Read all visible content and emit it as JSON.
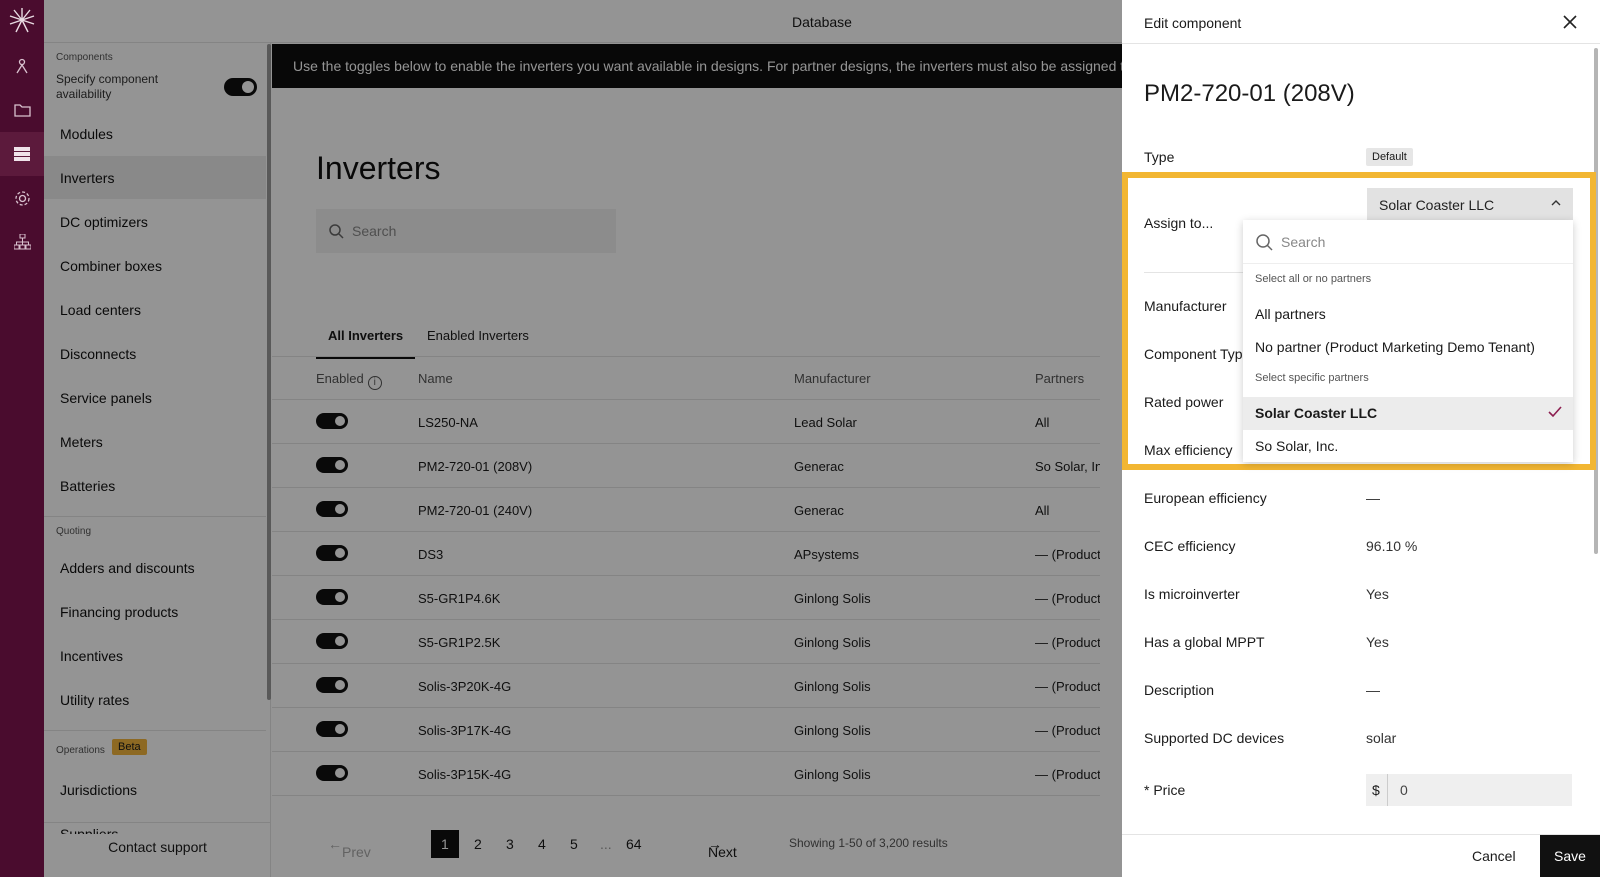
{
  "app": {
    "title": "Database"
  },
  "banner": "Use the toggles below to enable the inverters you want available in designs. For partner designs, the inverters must also be assigned to",
  "sidebar": {
    "components_title": "Components",
    "availability_label": "Specify component availability",
    "components": [
      "Modules",
      "Inverters",
      "DC optimizers",
      "Combiner boxes",
      "Load centers",
      "Disconnects",
      "Service panels",
      "Meters",
      "Batteries"
    ],
    "quoting_title": "Quoting",
    "quoting": [
      "Adders and discounts",
      "Financing products",
      "Incentives",
      "Utility rates"
    ],
    "operations_title": "Operations",
    "beta": "Beta",
    "operations": [
      "Jurisdictions",
      "Suppliers"
    ],
    "contact": "Contact support"
  },
  "main": {
    "title": "Inverters",
    "search_placeholder": "Search",
    "tabs": [
      "All Inverters",
      "Enabled Inverters"
    ],
    "columns": [
      "Enabled",
      "Name",
      "Manufacturer",
      "Partners"
    ],
    "rows": [
      {
        "name": "LS250-NA",
        "manufacturer": "Lead Solar",
        "partners": "All"
      },
      {
        "name": "PM2-720-01 (208V)",
        "manufacturer": "Generac",
        "partners": "So Solar, Inc."
      },
      {
        "name": "PM2-720-01 (240V)",
        "manufacturer": "Generac",
        "partners": "All"
      },
      {
        "name": "DS3",
        "manufacturer": "APsystems",
        "partners": "— (Product M"
      },
      {
        "name": "S5-GR1P4.6K",
        "manufacturer": "Ginlong Solis",
        "partners": "— (Product M"
      },
      {
        "name": "S5-GR1P2.5K",
        "manufacturer": "Ginlong Solis",
        "partners": "— (Product M"
      },
      {
        "name": "Solis-3P20K-4G",
        "manufacturer": "Ginlong Solis",
        "partners": "— (Product M"
      },
      {
        "name": "Solis-3P17K-4G",
        "manufacturer": "Ginlong Solis",
        "partners": "— (Product M"
      },
      {
        "name": "Solis-3P15K-4G",
        "manufacturer": "Ginlong Solis",
        "partners": "— (Product M"
      }
    ],
    "pager": {
      "prev": "Prev",
      "pages": [
        "1",
        "2",
        "3",
        "4",
        "5",
        "...",
        "64"
      ],
      "next": "Next",
      "summary": "Showing 1-50 of 3,200 results"
    }
  },
  "drawer": {
    "header": "Edit component",
    "title": "PM2-720-01 (208V)",
    "type_label": "Type",
    "type_value": "Default",
    "assign_label": "Assign to...",
    "assign_value": "Solar Coaster LLC",
    "dropdown": {
      "search_placeholder": "Search",
      "group1": "Select all or no partners",
      "opt_all": "All partners",
      "opt_none": "No partner (Product Marketing Demo Tenant)",
      "group2": "Select specific partners",
      "opt_selected": "Solar Coaster LLC",
      "opt_other": "So Solar, Inc."
    },
    "fields": [
      {
        "label": "Manufacturer",
        "value": ""
      },
      {
        "label": "Component Type",
        "value": ""
      },
      {
        "label": "Rated power",
        "value": ""
      },
      {
        "label": "Max efficiency",
        "value": ""
      },
      {
        "label": "European efficiency",
        "value": "—"
      },
      {
        "label": "CEC efficiency",
        "value": "96.10 %"
      },
      {
        "label": "Is microinverter",
        "value": "Yes"
      },
      {
        "label": "Has a global MPPT",
        "value": "Yes"
      },
      {
        "label": "Description",
        "value": "—"
      },
      {
        "label": "Supported DC devices",
        "value": "solar"
      }
    ],
    "price_label": "* Price",
    "price_currency": "$",
    "price_value": "0",
    "cancel": "Cancel",
    "save": "Save"
  },
  "colors": {
    "rail": "#4a0c2e",
    "highlight": "#f2b632",
    "beta": "#f3b53d"
  }
}
